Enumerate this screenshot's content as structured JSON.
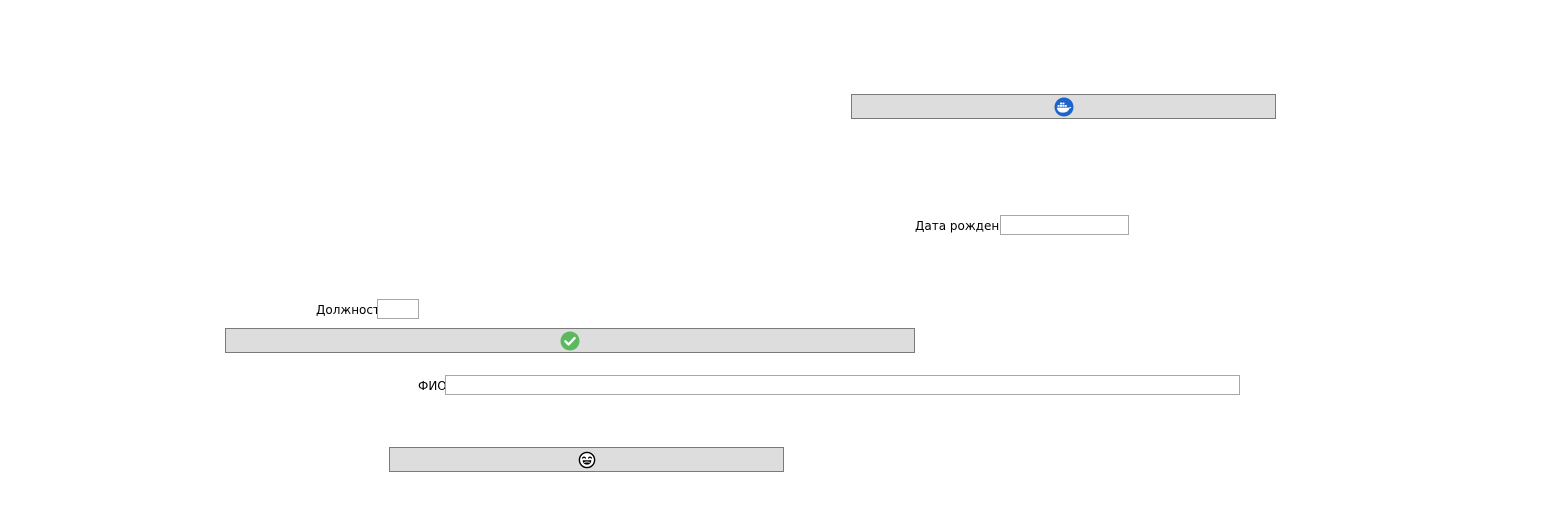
{
  "labels": {
    "birth_date": "Дата рождения",
    "position": "Должность",
    "full_name": "ФИО"
  },
  "fields": {
    "birth_date": {
      "value": "",
      "placeholder": ""
    },
    "position": {
      "value": "",
      "placeholder": ""
    },
    "full_name": {
      "value": "",
      "placeholder": ""
    }
  },
  "buttons": {
    "top": {
      "icon": "docker-whale-icon"
    },
    "confirm": {
      "icon": "check-circle-icon"
    },
    "bottom": {
      "icon": "laughing-face-icon"
    }
  },
  "colors": {
    "button_bg": "#dddddd",
    "button_border": "#7a7a7a",
    "field_border": "#a7a7a7",
    "docker_blue": "#1d63c8",
    "check_green": "#5cb85c"
  }
}
